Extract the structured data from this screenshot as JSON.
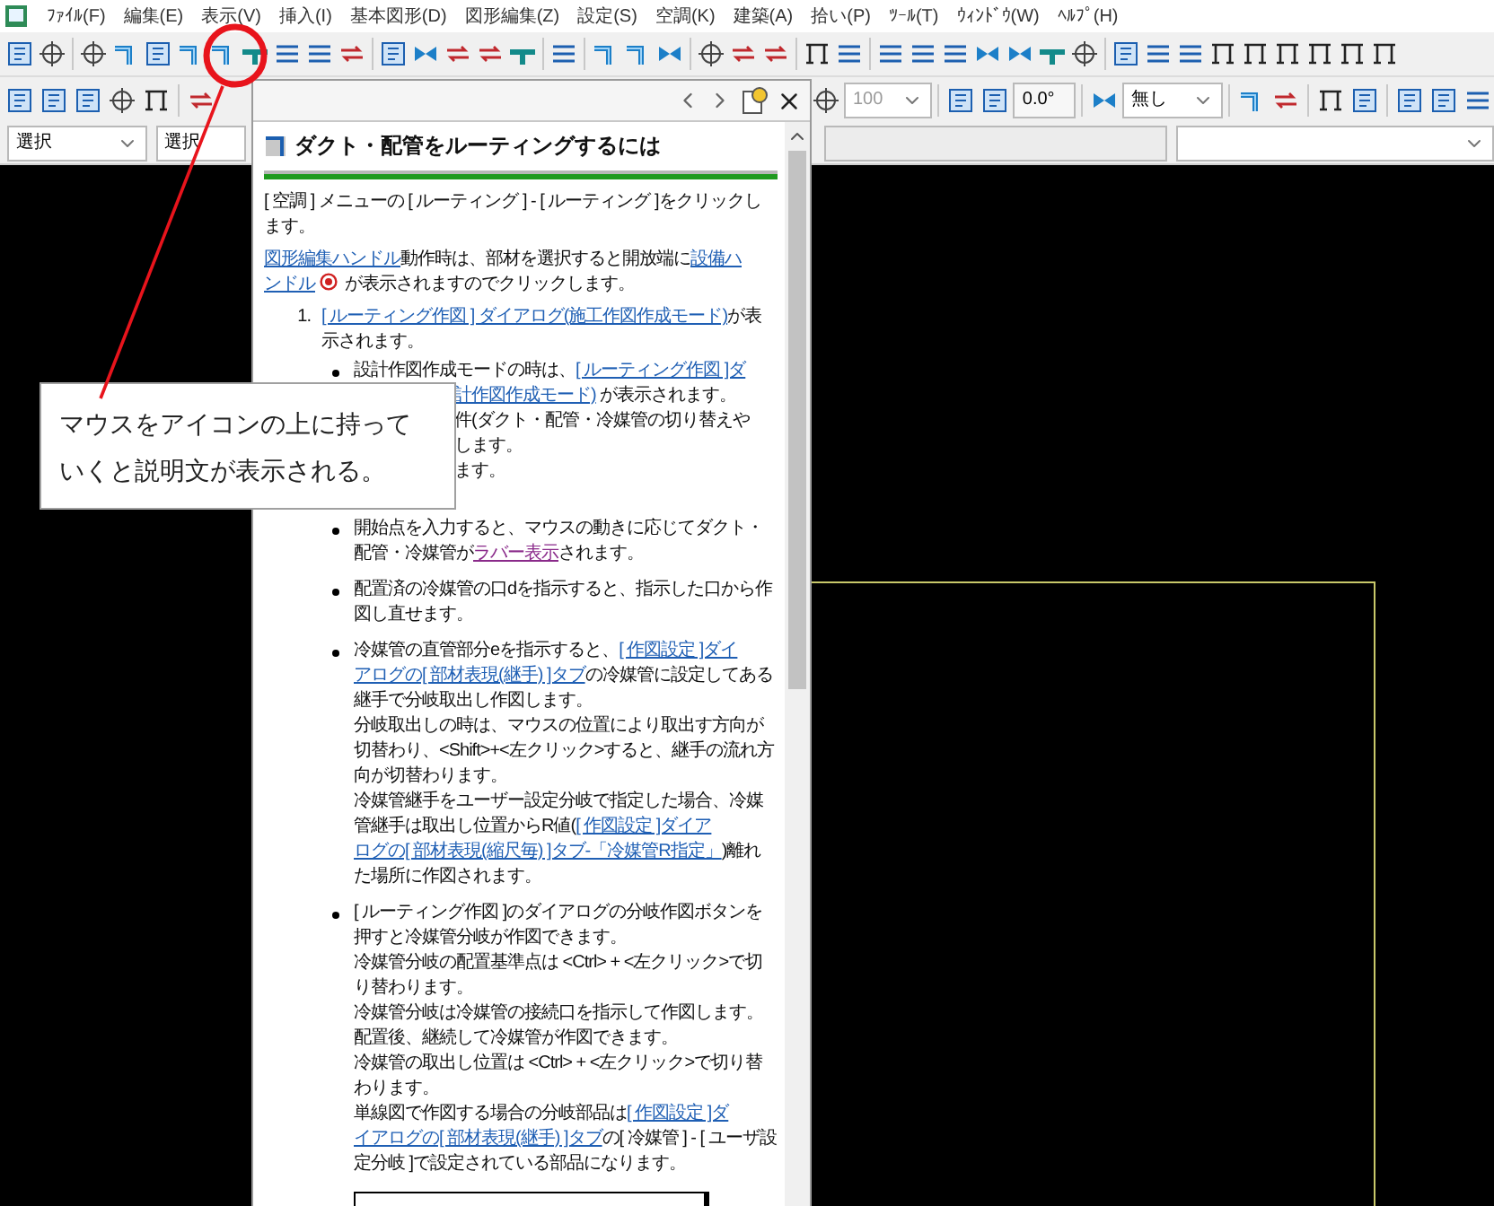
{
  "menu_bar": {
    "items": [
      "ﾌｧｲﾙ(F)",
      "編集(E)",
      "表示(V)",
      "挿入(I)",
      "基本図形(D)",
      "図形編集(Z)",
      "設定(S)",
      "空調(K)",
      "建築(A)",
      "拾い(P)",
      "ﾂｰﾙ(T)",
      "ｳｨﾝﾄﾞｳ(W)",
      "ﾍﾙﾌﾟ(H)"
    ]
  },
  "toolbar_2": {
    "zoom_select": {
      "value": "100",
      "disabled": true
    },
    "angle_field": {
      "value": "0.0°"
    },
    "line_select": {
      "value": "無し"
    }
  },
  "selectors": [
    {
      "value": "選択"
    },
    {
      "value": "選択"
    }
  ],
  "help_window": {
    "title": "ダクト・配管をルーティングするには",
    "intro": [
      [
        {
          "kind": "text",
          "text": "[ 空調 ] メニューの [ ルーティング ] - [ ルーティング ]をクリックします。"
        }
      ],
      [
        {
          "kind": "link",
          "text": "図形編集ハンドル"
        },
        {
          "kind": "text",
          "text": "動作時は、部材を選択すると開放端に"
        },
        {
          "kind": "link",
          "text": "設備ハ"
        },
        {
          "kind": "link",
          "text": "ンドル"
        },
        {
          "kind": "icon"
        },
        {
          "kind": "text",
          "text": " が表示されますのでクリックします。"
        }
      ]
    ],
    "steps": [
      {
        "number": "1.",
        "segments": [
          {
            "kind": "link",
            "text": "[ ルーティング作図 ] ダイアログ(施工作図作成モード)"
          },
          {
            "kind": "text",
            "text": "が表示されます。"
          }
        ],
        "bullets": [
          {
            "kind": "partial",
            "lines": [
              [
                {
                  "kind": "text",
                  "text": "設計作図作成モードの時は、"
                },
                {
                  "kind": "link",
                  "text": "[ ルーティング作図 ]ダ"
                }
              ],
              [
                {
                  "kind": "link",
                  "text": "計作図作成モード)"
                },
                {
                  "kind": "text",
                  "text": " が表示されます。"
                }
              ],
              [
                {
                  "kind": "text",
                  "text": "件(ダクト・配管・冷媒管の切り替えや"
                }
              ],
              [
                {
                  "kind": "text",
                  "text": "します。"
                }
              ],
              [
                {
                  "kind": "text",
                  "text": "ます。"
                }
              ]
            ]
          },
          {
            "kind": "text",
            "segments": [
              {
                "kind": "text",
                "text": "開始点を入力すると、マウスの動きに応じてダクト・配管・冷媒管が"
              },
              {
                "kind": "visited",
                "text": "ラバー表示"
              },
              {
                "kind": "text",
                "text": "されます。"
              }
            ]
          },
          {
            "kind": "text",
            "segments": [
              {
                "kind": "text",
                "text": "配置済の冷媒管の口dを指示すると、指示した口から作図し直せます。"
              }
            ]
          },
          {
            "kind": "text",
            "segments": [
              {
                "kind": "text",
                "text": "冷媒管の直管部分eを指示すると、"
              },
              {
                "kind": "link",
                "text": "[ 作図設定 ]ダイ"
              },
              {
                "kind": "link",
                "text": "アログの[ 部材表現(継手) ]タブ"
              },
              {
                "kind": "text",
                "text": "の冷媒管に設定してある継手で分岐取出し作図します。"
              },
              {
                "kind": "break"
              },
              {
                "kind": "text",
                "text": "分岐取出しの時は、マウスの位置により取出す方向が切替わり、<Shift>+<左クリック>すると、継手の流れ方向が切替わります。"
              },
              {
                "kind": "break"
              },
              {
                "kind": "text",
                "text": "冷媒管継手をユーザー設定分岐で指定した場合、冷媒管継手は取出し位置からR値("
              },
              {
                "kind": "link",
                "text": "[ 作図設定 ]ダイア"
              },
              {
                "kind": "link",
                "text": "ログの[ 部材表現(縮尺毎) ]タブ-「冷媒管R指定」"
              },
              {
                "kind": "text",
                "text": ")離れた場所に作図されます。"
              }
            ]
          },
          {
            "kind": "text",
            "segments": [
              {
                "kind": "text",
                "text": "[ ルーティング作図 ]のダイアログの分岐作図ボタンを押すと冷媒管分岐が作図できます。"
              },
              {
                "kind": "break"
              },
              {
                "kind": "text",
                "text": "冷媒管分岐の配置基準点は <Ctrl> + <左クリック>で切り替わります。"
              },
              {
                "kind": "break"
              },
              {
                "kind": "text",
                "text": "冷媒管分岐は冷媒管の接続口を指示して作図します。配置後、継続して冷媒管が作図できます。"
              },
              {
                "kind": "break"
              },
              {
                "kind": "text",
                "text": "冷媒管の取出し位置は <Ctrl> + <左クリック>で切り替わります。"
              },
              {
                "kind": "break"
              },
              {
                "kind": "text",
                "text": "単線図で作図する場合の分岐部品は"
              },
              {
                "kind": "link",
                "text": "[ 作図設定 ]ダ"
              },
              {
                "kind": "link",
                "text": "イアログの[ 部材表現(継手) ]タブ"
              },
              {
                "kind": "text",
                "text": "の[ 冷媒管 ] - [ ユーザ設定分岐 ]で設定されている部品になります。"
              }
            ]
          }
        ]
      }
    ]
  },
  "callout": {
    "text": "マウスをアイコンの上に持っていくと説明文が表示される。"
  }
}
